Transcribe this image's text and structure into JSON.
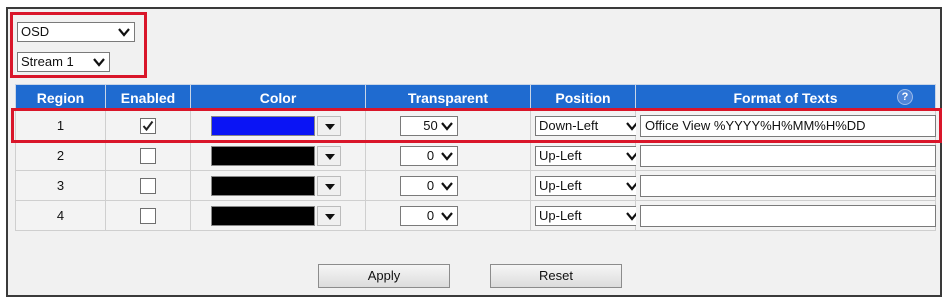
{
  "mode_select": {
    "value": "OSD"
  },
  "stream_select": {
    "value": "Stream 1"
  },
  "table": {
    "headers": {
      "region": "Region",
      "enabled": "Enabled",
      "color": "Color",
      "transparent": "Transparent",
      "position": "Position",
      "format": "Format of Texts"
    },
    "help_icon": "?",
    "rows": [
      {
        "region": "1",
        "enabled": true,
        "color": "#0a14f5",
        "transparent": "50",
        "position": "Down-Left",
        "format": "Office View %YYYY%H%MM%H%DD"
      },
      {
        "region": "2",
        "enabled": false,
        "color": "#000000",
        "transparent": "0",
        "position": "Up-Left",
        "format": ""
      },
      {
        "region": "3",
        "enabled": false,
        "color": "#000000",
        "transparent": "0",
        "position": "Up-Left",
        "format": ""
      },
      {
        "region": "4",
        "enabled": false,
        "color": "#000000",
        "transparent": "0",
        "position": "Up-Left",
        "format": ""
      }
    ]
  },
  "buttons": {
    "apply": "Apply",
    "reset": "Reset"
  },
  "colors": {
    "header_bg": "#1f6bd0",
    "highlight_border": "#d9162a"
  },
  "icons": {
    "dropdown": "chevron-down-icon",
    "color_dropdown": "triangle-down-icon",
    "checkbox": "checkmark-icon",
    "help": "help-icon"
  }
}
